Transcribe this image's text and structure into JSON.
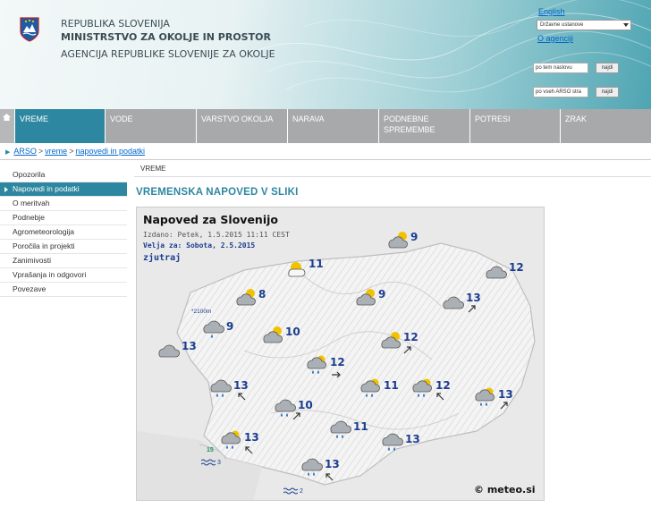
{
  "header": {
    "title_line1": "REPUBLIKA SLOVENIJA",
    "title_line2": "MINISTRSTVO ZA OKOLJE IN PROSTOR",
    "title_line3": "AGENCIJA REPUBLIKE SLOVENIJE ZA OKOLJE",
    "lang_link": "English",
    "institution_select": "Državne ustanove",
    "about_link": "O agenciji",
    "search_site_placeholder": "po tem naslovu",
    "search_site_button": "najdi",
    "search_all_placeholder": "po vseh ARSO stra",
    "search_all_button": "najdi"
  },
  "nav": {
    "items": [
      "VREME",
      "VODE",
      "VARSTVO OKOLJA",
      "NARAVA",
      "PODNEBNE SPREMEMBE",
      "POTRESI",
      "ZRAK"
    ]
  },
  "breadcrumb": {
    "root": "ARSO",
    "level1": "vreme",
    "level2": "napovedi in podatki",
    "sep": ">"
  },
  "sidebar": {
    "items": [
      "Opozorila",
      "Napovedi in podatki",
      "O meritvah",
      "Podnebje",
      "Agrometeorologija",
      "Poročila in projekti",
      "Zanimivosti",
      "Vprašanja in odgovori",
      "Povezave"
    ]
  },
  "content": {
    "section_label": "VREME",
    "heading": "VREMENSKA NAPOVED V SLIKI"
  },
  "map": {
    "title": "Napoved za Slovenijo",
    "issued": "Izdano: Petek, 1.5.2015 11:11 CEST",
    "valid": "Velja za: Sobota, 2.5.2015",
    "period": "zjutraj",
    "elevation_label": "*2100m",
    "brand": "© meteo.si",
    "sea_temp": "15",
    "sea_state_1": "3",
    "sea_state_2": "2",
    "stations": [
      {
        "icon": "partly-cloudy-icon",
        "temp": "9"
      },
      {
        "icon": "sun-behind-cloud-icon",
        "temp": "11"
      },
      {
        "icon": "cloudy-icon",
        "temp": "12"
      },
      {
        "icon": "partly-cloudy-icon",
        "temp": "8"
      },
      {
        "icon": "partly-cloudy-icon",
        "temp": "9"
      },
      {
        "icon": "cloudy-icon",
        "temp": "13"
      },
      {
        "icon": "light-rain-icon",
        "temp": "9"
      },
      {
        "icon": "cloudy-icon",
        "temp": "13"
      },
      {
        "icon": "partly-cloudy-icon",
        "temp": "10"
      },
      {
        "icon": "partly-cloudy-icon",
        "temp": "12"
      },
      {
        "icon": "sun-rain-icon",
        "temp": "12"
      },
      {
        "icon": "rain-icon",
        "temp": "13"
      },
      {
        "icon": "sun-rain-icon",
        "temp": "11"
      },
      {
        "icon": "sun-rain-icon",
        "temp": "12"
      },
      {
        "icon": "rain-icon",
        "temp": "10"
      },
      {
        "icon": "sun-rain-icon",
        "temp": "13"
      },
      {
        "icon": "rain-icon",
        "temp": "11"
      },
      {
        "icon": "sun-rain-icon",
        "temp": "13"
      },
      {
        "icon": "rain-icon",
        "temp": "13"
      },
      {
        "icon": "rain-icon",
        "temp": "13"
      }
    ]
  }
}
